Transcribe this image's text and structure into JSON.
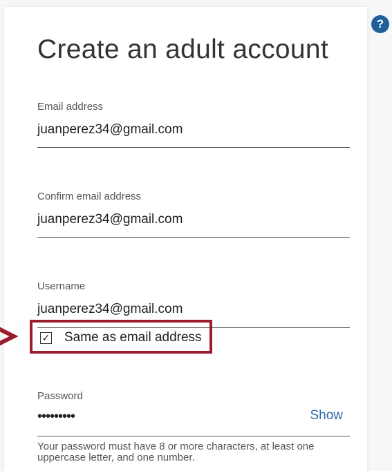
{
  "form": {
    "title": "Create an adult account",
    "help_label": "?"
  },
  "email": {
    "label": "Email address",
    "value": "juanperez34@gmail.com"
  },
  "confirm_email": {
    "label": "Confirm email address",
    "value": "juanperez34@gmail.com"
  },
  "username": {
    "label": "Username",
    "value": "juanperez34@gmail.com",
    "same_as_email": {
      "label": "Same as email address",
      "checked": true,
      "check_glyph": "✓"
    }
  },
  "password": {
    "label": "Password",
    "masked_value": "•••••••••",
    "show_label": "Show",
    "hint": "Your password must have 8 or more characters, at least one uppercase letter, and one number."
  },
  "colors": {
    "highlight": "#9b1c2e",
    "link": "#2a6aa7",
    "help_icon": "#1f5f9c"
  }
}
